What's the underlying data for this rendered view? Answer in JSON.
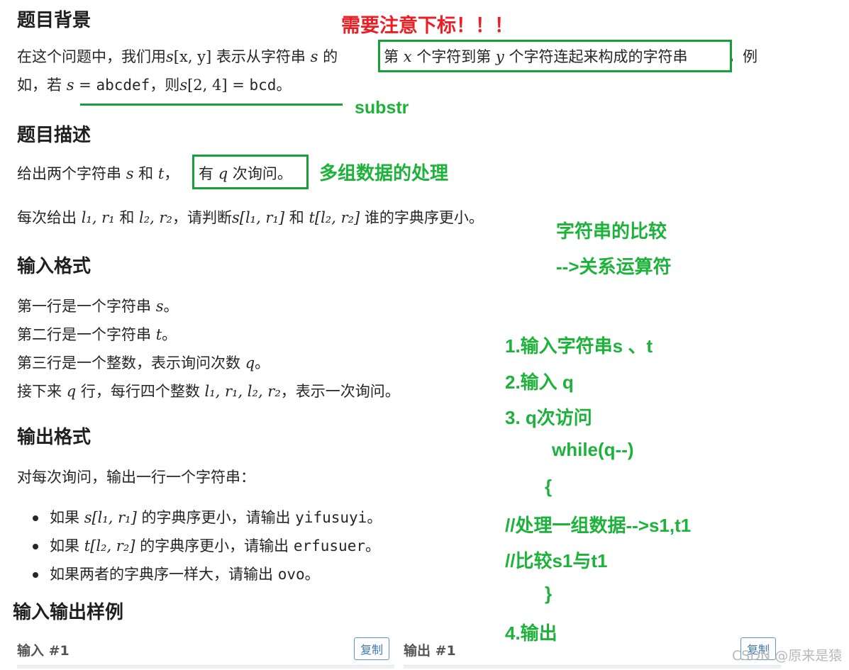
{
  "sections": {
    "background_title": "题目背景",
    "description_title": "题目描述",
    "input_title": "输入格式",
    "output_title": "输出格式",
    "samples_title": "输入输出样例"
  },
  "background": {
    "l1_a": "在这个问题中，我们用",
    "l1_s": "s",
    "l1_bx": "[x, y]",
    "l1_b": "表示从字符串",
    "l1_s2": "s",
    "l1_de": "的",
    "l1_c": "第",
    "l1_x": "x",
    "l1_d": "个字符到第",
    "l1_y": "y",
    "l1_e": "个字符连起来构成的字符串",
    "l1_f": "，例",
    "l2_a": "如，若",
    "l2_s": "s",
    "l2_eq": "=",
    "l2_val": "abcdef",
    "l2_b": "，则",
    "l2_s2": "s",
    "l2_idx": "[2, 4] =",
    "l2_val2": "bcd",
    "l2_end": "。"
  },
  "description": {
    "l1_a": "给出两个字符串",
    "l1_s": "s",
    "l1_and": "和",
    "l1_t": "t",
    "l1_comma": "，",
    "l1_b": "有",
    "l1_q": "q",
    "l1_c": "次询问。",
    "l2_a": "每次给出",
    "l2_m1": "l₁, r₁",
    "l2_and": "和",
    "l2_m2": "l₂, r₂",
    "l2_b": "，请判断",
    "l2_m3": "s[l₁, r₁]",
    "l2_and2": "和",
    "l2_m4": "t[l₂, r₂]",
    "l2_c": "谁的字典序更小。"
  },
  "input": {
    "l1_a": "第一行是一个字符串",
    "l1_m": "s",
    "l1_b": "。",
    "l2_a": "第二行是一个字符串",
    "l2_m": "t",
    "l2_b": "。",
    "l3_a": "第三行是一个整数，表示询问次数",
    "l3_m": "q",
    "l3_b": "。",
    "l4_a": "接下来",
    "l4_q": "q",
    "l4_b": "行，每行四个整数",
    "l4_m": "l₁, r₁, l₂, r₂",
    "l4_c": "，表示一次询问。"
  },
  "output": {
    "intro": "对每次询问，输出一行一个字符串：",
    "b1_a": "如果",
    "b1_m": "s[l₁, r₁]",
    "b1_b": "的字典序更小，请输出",
    "b1_v": "yifusuyi",
    "b1_c": "。",
    "b2_a": "如果",
    "b2_m": "t[l₂, r₂]",
    "b2_b": "的字典序更小，请输出",
    "b2_v": "erfusuer",
    "b2_c": "。",
    "b3_a": "如果两者的字典序一样大，请输出",
    "b3_v": "ovo",
    "b3_c": "。"
  },
  "samples": {
    "input_label": "输入 #1",
    "output_label": "输出 #1",
    "copy_label": "复制"
  },
  "annotations": {
    "index_note": "需要注意下标！！！",
    "substr": "substr",
    "multi_group": "多组数据的处理",
    "compare_1": "字符串的比较",
    "compare_2": "-->关系运算符",
    "step1": "1.输入字符串s 、t",
    "step2": "2.输入 q",
    "step3": "3. q次访问",
    "loop": "while(q--)",
    "brace_open": "{",
    "process": "//处理一组数据-->s1,t1",
    "compare": "//比较s1与t1",
    "brace_close": "}",
    "step4": "4.输出"
  },
  "watermark": "CSDN @原来是猿",
  "colors": {
    "annotation_green": "#1db23a",
    "annotation_red": "#ee1d24",
    "box_green": "#1a9e3c",
    "text": "#262626"
  }
}
